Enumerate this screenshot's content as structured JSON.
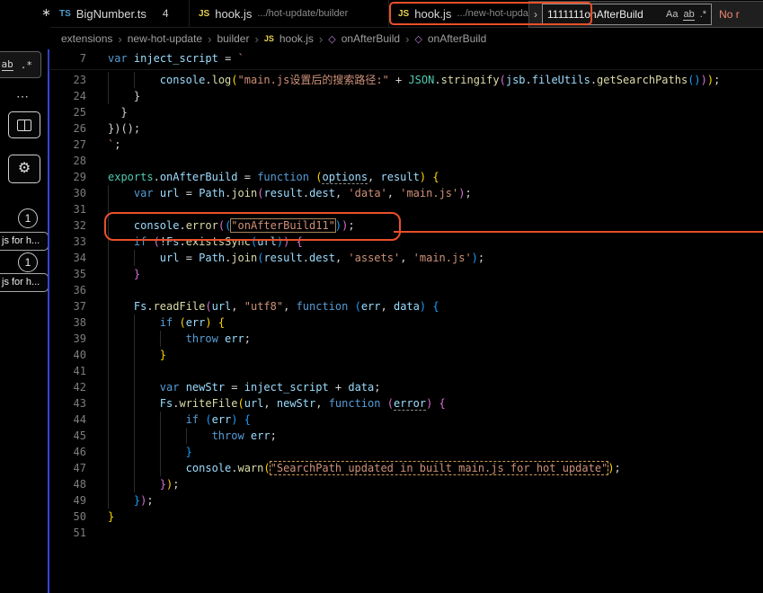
{
  "left_rail": {
    "corner_mark": "∗",
    "mini_find": {
      "word_toggle": "ab",
      "regex_toggle": ".*"
    },
    "overflow_ellipsis": "⋯",
    "gear_glyph": "⚙",
    "badge_top": "1",
    "badge_bottom": "1",
    "item_top": "js for h...",
    "item_bottom": "js for h..."
  },
  "tabs": [
    {
      "icon": "TS",
      "label": "BigNumber.ts",
      "badge": "4"
    },
    {
      "icon": "JS",
      "label": "hook.js",
      "desc": ".../hot-update/builder"
    },
    {
      "icon": "JS",
      "label": "hook.js",
      "desc": ".../new-hot-update/...",
      "close": "×"
    }
  ],
  "breadcrumb": {
    "separator": "›",
    "js_icon_label": "JS",
    "symbol_glyph": "◇",
    "items": [
      "extensions",
      "new-hot-update",
      "builder",
      "hook.js",
      "onAfterBuild",
      "onAfterBuild"
    ]
  },
  "find_widget": {
    "expand_chevron": "›",
    "query": "1111111onAfterBuild",
    "match_case": "Aa",
    "whole_word": "ab",
    "regex": ".*",
    "results": "No r"
  },
  "editor": {
    "sticky_line": {
      "num": "7",
      "tokens": [
        [
          "kw",
          "var"
        ],
        [
          "pl",
          " "
        ],
        [
          "vr",
          "inject_script"
        ],
        [
          "pl",
          " = "
        ],
        [
          "st",
          "`"
        ]
      ]
    },
    "lines": [
      {
        "num": "23",
        "g": 2,
        "tokens": [
          [
            "vr",
            "console"
          ],
          [
            "pl",
            "."
          ],
          [
            "fn",
            "log"
          ],
          [
            "b1",
            "("
          ],
          [
            "st",
            "\"main.js设置后的搜索路径:\""
          ],
          [
            "pl",
            " + "
          ],
          [
            "md",
            "JSON"
          ],
          [
            "pl",
            "."
          ],
          [
            "fn",
            "stringify"
          ],
          [
            "b2",
            "("
          ],
          [
            "vr",
            "jsb"
          ],
          [
            "pl",
            "."
          ],
          [
            "vr",
            "fileUtils"
          ],
          [
            "pl",
            "."
          ],
          [
            "fn",
            "getSearchPaths"
          ],
          [
            "b3",
            "()"
          ],
          [
            "b2",
            ")"
          ],
          [
            "b1",
            ")"
          ],
          [
            "pl",
            ";"
          ]
        ]
      },
      {
        "num": "24",
        "g": 1,
        "tokens": [
          [
            "pl",
            "}"
          ]
        ]
      },
      {
        "num": "25",
        "sp": "  ",
        "tokens": [
          [
            "pl",
            "}"
          ]
        ]
      },
      {
        "num": "26",
        "tokens": [
          [
            "pl",
            "})();"
          ]
        ]
      },
      {
        "num": "27",
        "tokens": [
          [
            "st",
            "`"
          ],
          [
            "pl",
            ";"
          ]
        ]
      },
      {
        "num": "28",
        "tokens": []
      },
      {
        "num": "29",
        "tokens": [
          [
            "md",
            "exports"
          ],
          [
            "pl",
            "."
          ],
          [
            "vr",
            "onAfterBuild"
          ],
          [
            "pl",
            " = "
          ],
          [
            "kw",
            "function"
          ],
          [
            "pl",
            " "
          ],
          [
            "b1",
            "("
          ],
          [
            "vru",
            "options"
          ],
          [
            "pl",
            ", "
          ],
          [
            "vr",
            "result"
          ],
          [
            "b1",
            ")"
          ],
          [
            "pl",
            " "
          ],
          [
            "b1",
            "{"
          ]
        ]
      },
      {
        "num": "30",
        "g": 1,
        "tokens": [
          [
            "kw",
            "var"
          ],
          [
            "pl",
            " "
          ],
          [
            "vr",
            "url"
          ],
          [
            "pl",
            " = "
          ],
          [
            "vr",
            "Path"
          ],
          [
            "pl",
            "."
          ],
          [
            "fn",
            "join"
          ],
          [
            "b2",
            "("
          ],
          [
            "vr",
            "result"
          ],
          [
            "pl",
            "."
          ],
          [
            "vr",
            "dest"
          ],
          [
            "pl",
            ", "
          ],
          [
            "st",
            "'data'"
          ],
          [
            "pl",
            ", "
          ],
          [
            "st",
            "'main.js'"
          ],
          [
            "b2",
            ")"
          ],
          [
            "pl",
            ";"
          ]
        ]
      },
      {
        "num": "31",
        "g": 1,
        "tokens": []
      },
      {
        "num": "32",
        "g": 1,
        "tokens": [
          [
            "vr",
            "console"
          ],
          [
            "pl",
            "."
          ],
          [
            "fn",
            "error"
          ],
          [
            "b2",
            "("
          ],
          [
            "b3",
            "("
          ],
          [
            "stm",
            "\"onAfterBuild11\""
          ],
          [
            "b3",
            ")"
          ],
          [
            "b2",
            ")"
          ],
          [
            "pl",
            ";"
          ]
        ]
      },
      {
        "num": "33",
        "g": 1,
        "tokens": [
          [
            "kw",
            "if"
          ],
          [
            "pl",
            " "
          ],
          [
            "b2",
            "("
          ],
          [
            "pl",
            "!"
          ],
          [
            "vr",
            "Fs"
          ],
          [
            "pl",
            "."
          ],
          [
            "fn",
            "existsSync"
          ],
          [
            "b3",
            "("
          ],
          [
            "vr",
            "url"
          ],
          [
            "b3",
            ")"
          ],
          [
            "b2",
            ")"
          ],
          [
            "pl",
            " "
          ],
          [
            "b2",
            "{"
          ]
        ]
      },
      {
        "num": "34",
        "g": 2,
        "tokens": [
          [
            "vr",
            "url"
          ],
          [
            "pl",
            " = "
          ],
          [
            "vr",
            "Path"
          ],
          [
            "pl",
            "."
          ],
          [
            "fn",
            "join"
          ],
          [
            "b3",
            "("
          ],
          [
            "vr",
            "result"
          ],
          [
            "pl",
            "."
          ],
          [
            "vr",
            "dest"
          ],
          [
            "pl",
            ", "
          ],
          [
            "st",
            "'assets'"
          ],
          [
            "pl",
            ", "
          ],
          [
            "st",
            "'main.js'"
          ],
          [
            "b3",
            ")"
          ],
          [
            "pl",
            ";"
          ]
        ]
      },
      {
        "num": "35",
        "g": 1,
        "tokens": [
          [
            "b2",
            "}"
          ]
        ]
      },
      {
        "num": "36",
        "g": 1,
        "tokens": []
      },
      {
        "num": "37",
        "g": 1,
        "tokens": [
          [
            "vr",
            "Fs"
          ],
          [
            "pl",
            "."
          ],
          [
            "fn",
            "readFile"
          ],
          [
            "b2",
            "("
          ],
          [
            "vr",
            "url"
          ],
          [
            "pl",
            ", "
          ],
          [
            "st",
            "\"utf8\""
          ],
          [
            "pl",
            ", "
          ],
          [
            "kw",
            "function"
          ],
          [
            "pl",
            " "
          ],
          [
            "b3",
            "("
          ],
          [
            "vr",
            "err"
          ],
          [
            "pl",
            ", "
          ],
          [
            "vr",
            "data"
          ],
          [
            "b3",
            ")"
          ],
          [
            "pl",
            " "
          ],
          [
            "b3",
            "{"
          ]
        ]
      },
      {
        "num": "38",
        "g": 2,
        "tokens": [
          [
            "kw",
            "if"
          ],
          [
            "pl",
            " "
          ],
          [
            "b1",
            "("
          ],
          [
            "vr",
            "err"
          ],
          [
            "b1",
            ")"
          ],
          [
            "pl",
            " "
          ],
          [
            "b1",
            "{"
          ]
        ]
      },
      {
        "num": "39",
        "g": 3,
        "tokens": [
          [
            "kw",
            "throw"
          ],
          [
            "pl",
            " "
          ],
          [
            "vr",
            "err"
          ],
          [
            "pl",
            ";"
          ]
        ]
      },
      {
        "num": "40",
        "g": 2,
        "tokens": [
          [
            "b1",
            "}"
          ]
        ]
      },
      {
        "num": "41",
        "g": 2,
        "tokens": []
      },
      {
        "num": "42",
        "g": 2,
        "tokens": [
          [
            "kw",
            "var"
          ],
          [
            "pl",
            " "
          ],
          [
            "vr",
            "newStr"
          ],
          [
            "pl",
            " = "
          ],
          [
            "vr",
            "inject_script"
          ],
          [
            "pl",
            " + "
          ],
          [
            "vr",
            "data"
          ],
          [
            "pl",
            ";"
          ]
        ]
      },
      {
        "num": "43",
        "g": 2,
        "tokens": [
          [
            "vr",
            "Fs"
          ],
          [
            "pl",
            "."
          ],
          [
            "fn",
            "writeFile"
          ],
          [
            "b1",
            "("
          ],
          [
            "vr",
            "url"
          ],
          [
            "pl",
            ", "
          ],
          [
            "vr",
            "newStr"
          ],
          [
            "pl",
            ", "
          ],
          [
            "kw",
            "function"
          ],
          [
            "pl",
            " "
          ],
          [
            "b2",
            "("
          ],
          [
            "vru",
            "error"
          ],
          [
            "b2",
            ")"
          ],
          [
            "pl",
            " "
          ],
          [
            "b2",
            "{"
          ]
        ]
      },
      {
        "num": "44",
        "g": 3,
        "tokens": [
          [
            "kw",
            "if"
          ],
          [
            "pl",
            " "
          ],
          [
            "b3",
            "("
          ],
          [
            "vr",
            "err"
          ],
          [
            "b3",
            ")"
          ],
          [
            "pl",
            " "
          ],
          [
            "b3",
            "{"
          ]
        ]
      },
      {
        "num": "45",
        "g": 4,
        "tokens": [
          [
            "kw",
            "throw"
          ],
          [
            "pl",
            " "
          ],
          [
            "vr",
            "err"
          ],
          [
            "pl",
            ";"
          ]
        ]
      },
      {
        "num": "46",
        "g": 3,
        "tokens": [
          [
            "b3",
            "}"
          ]
        ]
      },
      {
        "num": "47",
        "g": 3,
        "tokens": [
          [
            "vr",
            "console"
          ],
          [
            "pl",
            "."
          ],
          [
            "fn",
            "warn"
          ],
          [
            "b1",
            "("
          ],
          [
            "sth",
            "\"SearchPath updated in built main.js for hot update\""
          ],
          [
            "b1",
            ")"
          ],
          [
            "pl",
            ";"
          ]
        ]
      },
      {
        "num": "48",
        "g": 2,
        "tokens": [
          [
            "b2",
            "}"
          ],
          [
            "b1",
            ")"
          ],
          [
            "pl",
            ";"
          ]
        ]
      },
      {
        "num": "49",
        "g": 1,
        "tokens": [
          [
            "b3",
            "}"
          ],
          [
            "b2",
            ")"
          ],
          [
            "pl",
            ";"
          ]
        ]
      },
      {
        "num": "50",
        "tokens": [
          [
            "b1",
            "}"
          ]
        ]
      },
      {
        "num": "51",
        "tokens": []
      }
    ]
  }
}
